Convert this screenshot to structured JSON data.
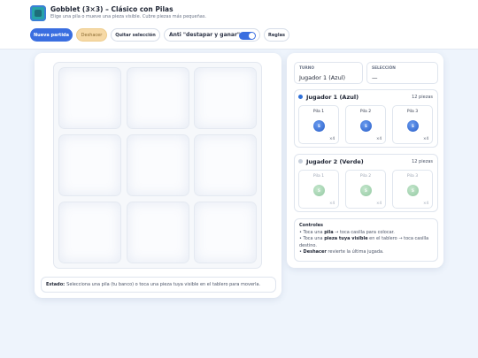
{
  "header": {
    "title": "Gobblet (3×3) – Clásico con Pilas",
    "subtitle": "Elige una pila o mueve una pieza visible. Cubre piezas más pequeñas."
  },
  "toolbar": {
    "new_game": "Nueva partida",
    "undo": "Deshacer",
    "clear_selection": "Quitar selección",
    "anti_label": "Anti \"destapar y ganar\"",
    "anti_enabled": true,
    "rules": "Reglas"
  },
  "board": {
    "cells": [
      "",
      "",
      "",
      "",
      "",
      "",
      "",
      "",
      ""
    ]
  },
  "status": {
    "label": "Estado:",
    "text": "Selecciona una pila (tu banco) o toca una pieza tuya visible en el tablero para moverla."
  },
  "info": {
    "turn_label": "TURNO",
    "turn_value": "Jugador 1 (Azul)",
    "selection_label": "SELECCIÓN",
    "selection_value": "—"
  },
  "players": [
    {
      "name": "Jugador 1 (Azul)",
      "count": "12 piezas",
      "color": "#2f6fd8",
      "piles": [
        {
          "label": "Pila 1",
          "piece": "S",
          "count": "×4"
        },
        {
          "label": "Pila 2",
          "piece": "S",
          "count": "×4"
        },
        {
          "label": "Pila 3",
          "piece": "S",
          "count": "×4"
        }
      ]
    },
    {
      "name": "Jugador 2 (Verde)",
      "count": "12 piezas",
      "color": "#a8d4b4",
      "piles": [
        {
          "label": "Pila 1",
          "piece": "S",
          "count": "×4"
        },
        {
          "label": "Pila 2",
          "piece": "S",
          "count": "×4"
        },
        {
          "label": "Pila 3",
          "piece": "S",
          "count": "×4"
        }
      ]
    }
  ],
  "controls": {
    "title": "Controles",
    "line1_pre": "• Toca una ",
    "line1_bold": "pila",
    "line1_post": " → toca casilla para colocar.",
    "line2_pre": "• Toca una ",
    "line2_bold": "pieza tuya visible",
    "line2_post": " en el tablero → toca casilla destino.",
    "line3_pre": "• ",
    "line3_bold": "Deshacer",
    "line3_post": " revierte la última jugada."
  }
}
